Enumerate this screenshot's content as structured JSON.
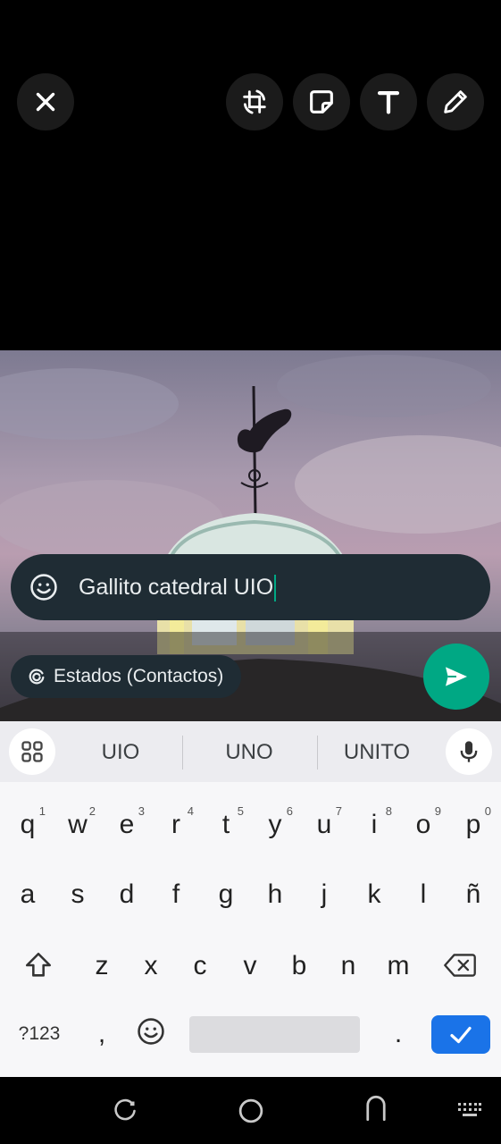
{
  "toolbar": {
    "close": "close-icon",
    "crop_rotate": "crop-rotate-icon",
    "sticker": "sticker-icon",
    "text": "text-icon",
    "draw": "pencil-icon"
  },
  "caption": {
    "value": "Gallito catedral UIO",
    "emoji_icon": "emoji-icon"
  },
  "audience": {
    "label": "Estados (Contactos)",
    "icon": "status-icon"
  },
  "send": {
    "icon": "send-icon"
  },
  "keyboard": {
    "suggestions": [
      "UIO",
      "UNO",
      "UNITO"
    ],
    "row1": [
      {
        "key": "q",
        "hint": "1"
      },
      {
        "key": "w",
        "hint": "2"
      },
      {
        "key": "e",
        "hint": "3"
      },
      {
        "key": "r",
        "hint": "4"
      },
      {
        "key": "t",
        "hint": "5"
      },
      {
        "key": "y",
        "hint": "6"
      },
      {
        "key": "u",
        "hint": "7"
      },
      {
        "key": "i",
        "hint": "8"
      },
      {
        "key": "o",
        "hint": "9"
      },
      {
        "key": "p",
        "hint": "0"
      }
    ],
    "row2": [
      "a",
      "s",
      "d",
      "f",
      "g",
      "h",
      "j",
      "k",
      "l",
      "ñ"
    ],
    "row3": [
      "z",
      "x",
      "c",
      "v",
      "b",
      "n",
      "m"
    ],
    "symbols_label": "?123",
    "comma": ",",
    "period": ".",
    "shift_icon": "shift-icon",
    "backspace_icon": "backspace-icon",
    "emoji_key_icon": "emoji-icon",
    "enter_icon": "checkmark-icon",
    "apps_icon": "grid-icon",
    "mic_icon": "microphone-icon"
  },
  "navbar": {
    "recents": "recents-icon",
    "home": "home-icon",
    "back": "back-icon",
    "keyboard": "keyboard-icon"
  },
  "colors": {
    "accent": "#00a884",
    "caption_bg": "#1f2c34",
    "enter_key": "#1a73e8"
  }
}
